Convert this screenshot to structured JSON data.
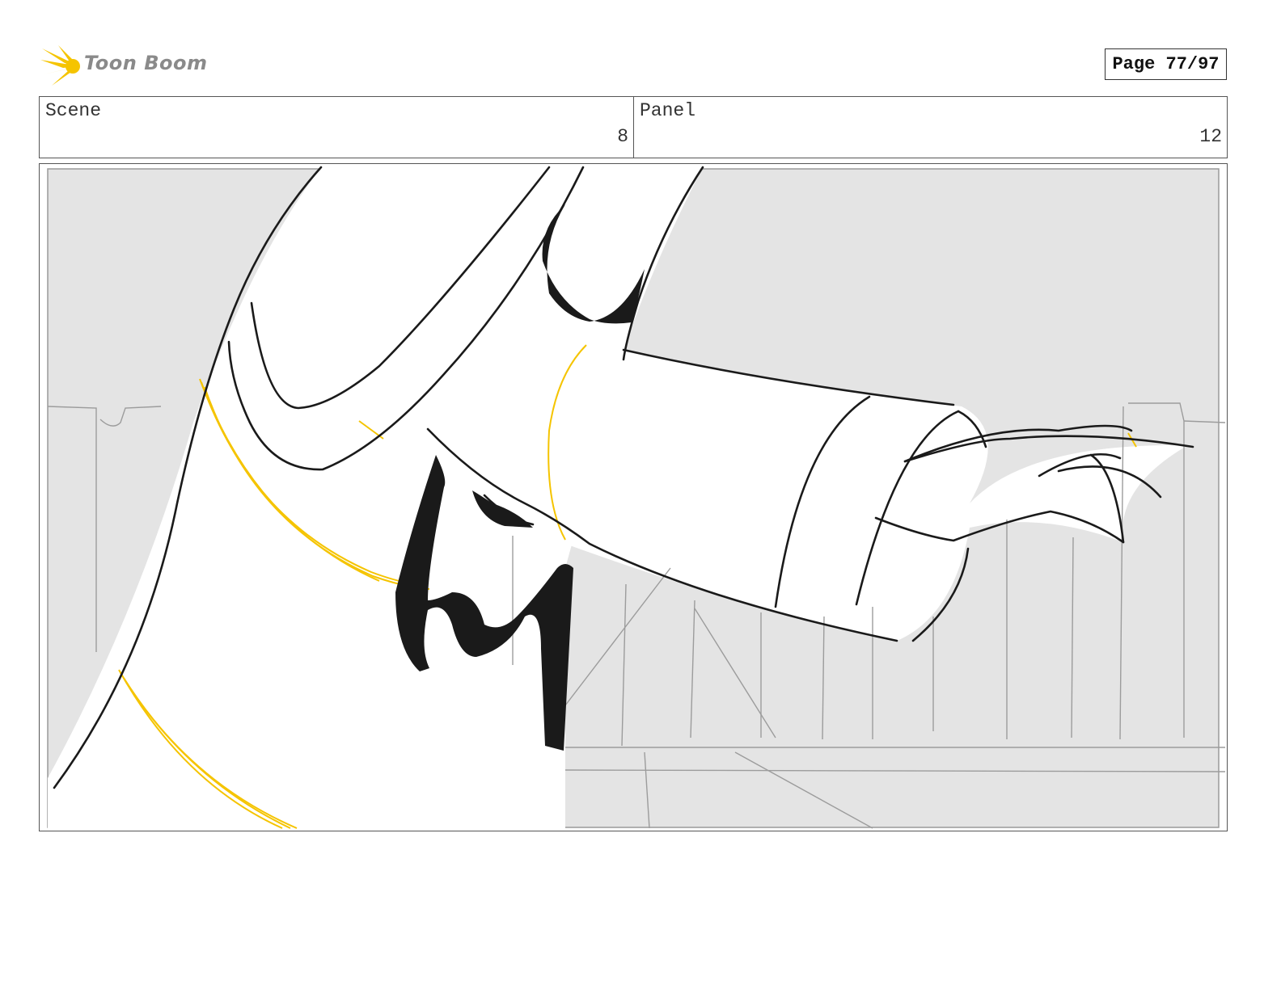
{
  "header": {
    "logo_text": "Toon Boom",
    "page_label": "Page 77/97"
  },
  "info": {
    "scene_label": "Scene",
    "scene_value": "8",
    "panel_label": "Panel",
    "panel_value": "12"
  },
  "colors": {
    "accent_yellow": "#f5c400",
    "ink": "#1a1a1a",
    "background_grey": "#e4e4e4"
  }
}
